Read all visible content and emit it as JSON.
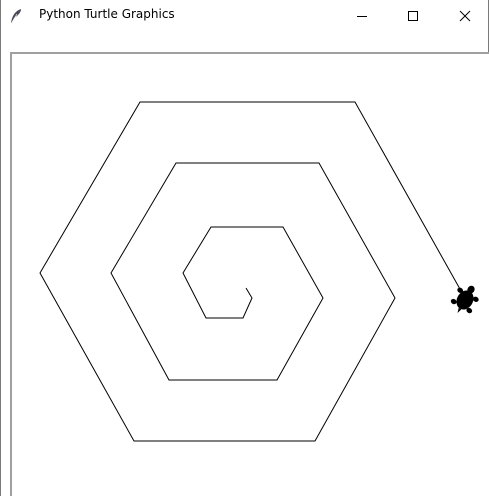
{
  "window": {
    "title": "Python Turtle Graphics",
    "controls": {
      "minimize": "—",
      "maximize": "☐",
      "close": "✕"
    },
    "icon": "feather-icon"
  },
  "canvas": {
    "background": "#ffffff",
    "pen_color": "#000000",
    "turtle_shape": "turtle",
    "turtle_color": "#000000",
    "turtle_heading_deg": 60
  }
}
